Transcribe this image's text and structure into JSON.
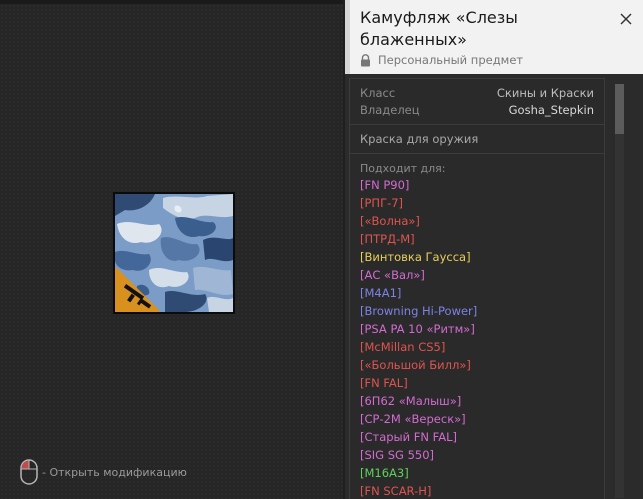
{
  "item": {
    "title": "Камуфляж «Слезы блаженных»",
    "subtitle": "Персональный предмет"
  },
  "info": {
    "class_label": "Класс",
    "class_value": "Скины и Краски",
    "owner_label": "Владелец",
    "owner_value": "Gosha_Stepkin"
  },
  "type_label": "Краска для оружия",
  "fits_label": "Подходит для:",
  "weapons": [
    {
      "name": "[FN P90]",
      "color": "#d36bd2"
    },
    {
      "name": "[РПГ-7]",
      "color": "#e0544f"
    },
    {
      "name": "[«Волна»]",
      "color": "#e0544f"
    },
    {
      "name": "[ПТРД-М]",
      "color": "#e0544f"
    },
    {
      "name": "[Винтовка Гаусса]",
      "color": "#e8cf5a"
    },
    {
      "name": "[АС «Вал»]",
      "color": "#d36bd2"
    },
    {
      "name": "[M4A1]",
      "color": "#7c83e6"
    },
    {
      "name": "[Browning Hi-Power]",
      "color": "#7c83e6"
    },
    {
      "name": "[PSA PA 10 «Ритм»]",
      "color": "#d36bd2"
    },
    {
      "name": "[McMillan CS5]",
      "color": "#e0544f"
    },
    {
      "name": "[«Большой Билл»]",
      "color": "#e0544f"
    },
    {
      "name": "[FN FAL]",
      "color": "#e0544f"
    },
    {
      "name": "[6П62 «Малыш»]",
      "color": "#d36bd2"
    },
    {
      "name": "[СР-2М «Вереск»]",
      "color": "#d36bd2"
    },
    {
      "name": "[Старый FN FAL]",
      "color": "#d36bd2"
    },
    {
      "name": "[SIG SG 550]",
      "color": "#d36bd2"
    },
    {
      "name": "[M16A3]",
      "color": "#5ed35a"
    },
    {
      "name": "[FN SCAR-H]",
      "color": "#e0544f"
    }
  ],
  "hint": {
    "text": "- Открыть модификацию"
  },
  "icons": {
    "lock": "lock-icon",
    "close": "close-icon",
    "mouse": "mouse-icon",
    "gun": "gun-icon"
  },
  "colors": {
    "badge": "#d8901f",
    "camo_base": "#7b9cc7"
  }
}
